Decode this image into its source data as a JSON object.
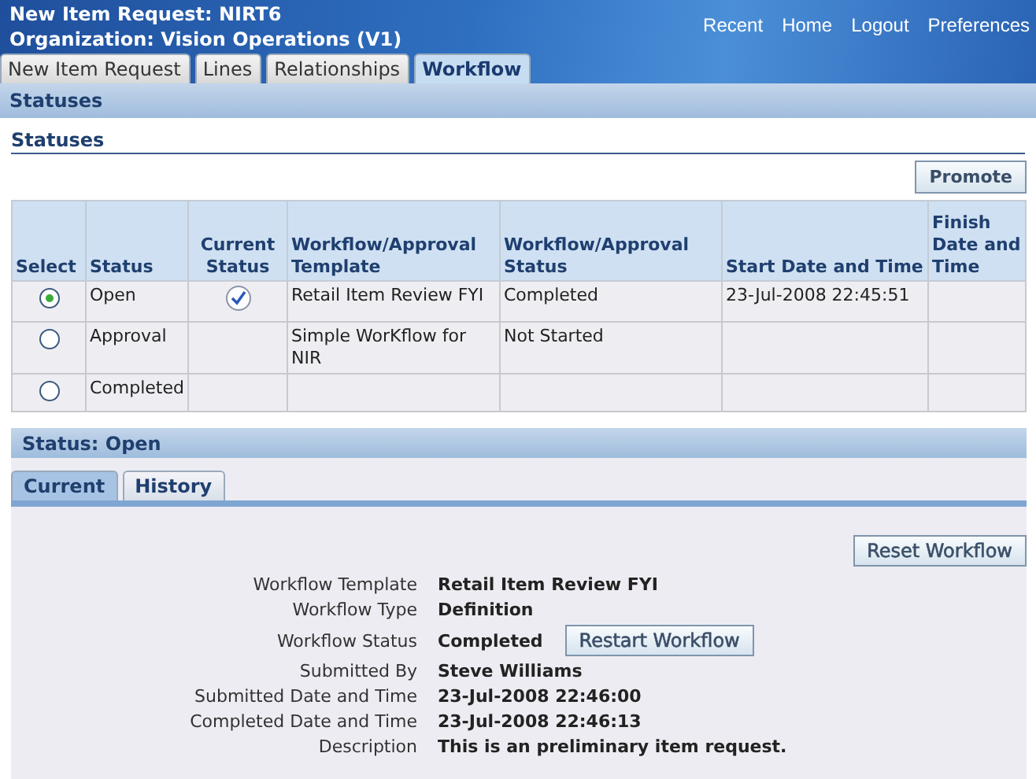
{
  "header": {
    "title": "New Item Request: NIRT6",
    "organization": "Organization: Vision Operations (V1)",
    "links": [
      "Recent",
      "Home",
      "Logout",
      "Preferences"
    ]
  },
  "tabs": [
    {
      "label": "New Item Request",
      "selected": false
    },
    {
      "label": "Lines",
      "selected": false
    },
    {
      "label": "Relationships",
      "selected": false
    },
    {
      "label": "Workflow",
      "selected": true
    }
  ],
  "section_title": "Statuses",
  "subsection_title": "Statuses",
  "promote_button": "Promote",
  "table": {
    "columns": [
      "Select",
      "Status",
      "Current Status",
      "Workflow/Approval Template",
      "Workflow/Approval Status",
      "Start Date and Time",
      "Finish Date and Time"
    ],
    "rows": [
      {
        "selected": true,
        "status": "Open",
        "current": true,
        "template": "Retail Item Review FYI",
        "wf_status": "Completed",
        "start": "23-Jul-2008 22:45:51"
      },
      {
        "selected": false,
        "status": "Approval",
        "current": false,
        "template": "Simple WorKflow for NIR",
        "wf_status": "Not Started"
      },
      {
        "selected": false,
        "status": "Completed",
        "current": false
      }
    ]
  },
  "status_bar": "Status: Open",
  "detail_tabs": [
    {
      "label": "Current",
      "selected": true
    },
    {
      "label": "History",
      "selected": false
    }
  ],
  "reset_button": "Reset Workflow",
  "restart_button": "Restart Workflow",
  "details": [
    {
      "label": "Workflow Template",
      "value": "Retail Item Review FYI"
    },
    {
      "label": "Workflow Type",
      "value": "Definition"
    },
    {
      "label": "Workflow Status",
      "value": "Completed",
      "kind": "restart"
    },
    {
      "label": "Submitted By",
      "value": "Steve Williams"
    },
    {
      "label": "Submitted Date and Time",
      "value": "23-Jul-2008 22:46:00"
    },
    {
      "label": "Completed Date and Time",
      "value": "23-Jul-2008 22:46:13"
    },
    {
      "label": "Description",
      "value": "This is an preliminary item request."
    }
  ]
}
